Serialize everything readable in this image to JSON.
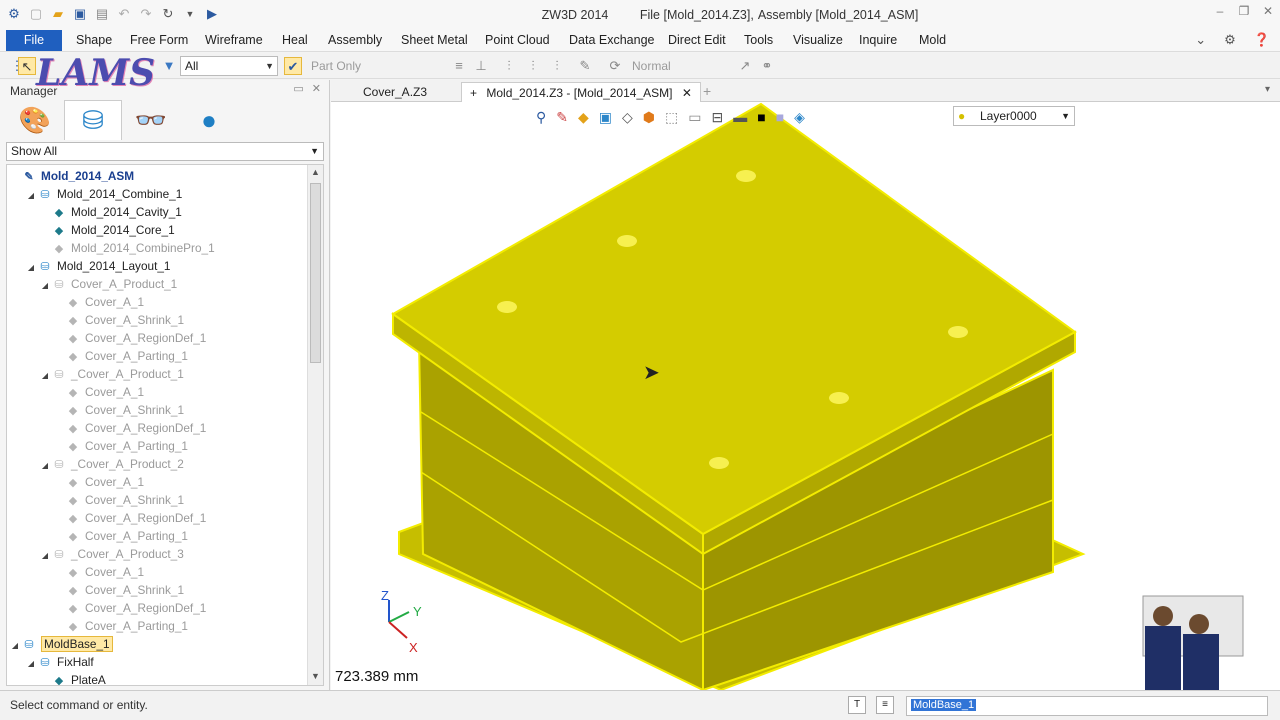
{
  "title": {
    "app": "ZW3D 2014",
    "file": "File [Mold_2014.Z3],",
    "object": "Assembly [Mold_2014_ASM]"
  },
  "menu": {
    "items": [
      "File",
      "Shape",
      "Free Form",
      "Wireframe",
      "Heal",
      "Assembly",
      "Sheet Metal",
      "Point Cloud",
      "Data Exchange",
      "Direct Edit",
      "Tools",
      "Visualize",
      "Inquire",
      "Mold"
    ]
  },
  "toolbar": {
    "filter": "All",
    "part_filter": "Part Only",
    "render_mode": "Normal"
  },
  "manager": {
    "title": "Manager",
    "show_filter": "Show All",
    "tree": [
      {
        "label": "Mold_2014_ASM",
        "depth": 0,
        "state": "root",
        "icon": "assembly-root-icon"
      },
      {
        "label": "Mold_2014_Combine_1",
        "depth": 1,
        "state": "normal",
        "icon": "assembly-icon",
        "exp": true
      },
      {
        "label": "Mold_2014_Cavity_1",
        "depth": 2,
        "state": "normal",
        "icon": "part-icon"
      },
      {
        "label": "Mold_2014_Core_1",
        "depth": 2,
        "state": "normal",
        "icon": "part-icon"
      },
      {
        "label": "Mold_2014_CombinePro_1",
        "depth": 2,
        "state": "dim",
        "icon": "part-icon"
      },
      {
        "label": "Mold_2014_Layout_1",
        "depth": 1,
        "state": "normal",
        "icon": "assembly-icon",
        "exp": true
      },
      {
        "label": "Cover_A_Product_1",
        "depth": 2,
        "state": "dim",
        "icon": "assembly-icon",
        "exp": true
      },
      {
        "label": "Cover_A_1",
        "depth": 3,
        "state": "dim",
        "icon": "part-icon"
      },
      {
        "label": "Cover_A_Shrink_1",
        "depth": 3,
        "state": "dim",
        "icon": "part-icon"
      },
      {
        "label": "Cover_A_RegionDef_1",
        "depth": 3,
        "state": "dim",
        "icon": "part-icon"
      },
      {
        "label": "Cover_A_Parting_1",
        "depth": 3,
        "state": "dim",
        "icon": "part-icon"
      },
      {
        "label": "_Cover_A_Product_1",
        "depth": 2,
        "state": "dim",
        "icon": "assembly-icon",
        "exp": true
      },
      {
        "label": "Cover_A_1",
        "depth": 3,
        "state": "dim",
        "icon": "part-icon"
      },
      {
        "label": "Cover_A_Shrink_1",
        "depth": 3,
        "state": "dim",
        "icon": "part-icon"
      },
      {
        "label": "Cover_A_RegionDef_1",
        "depth": 3,
        "state": "dim",
        "icon": "part-icon"
      },
      {
        "label": "Cover_A_Parting_1",
        "depth": 3,
        "state": "dim",
        "icon": "part-icon"
      },
      {
        "label": "_Cover_A_Product_2",
        "depth": 2,
        "state": "dim",
        "icon": "assembly-icon",
        "exp": true
      },
      {
        "label": "Cover_A_1",
        "depth": 3,
        "state": "dim",
        "icon": "part-icon"
      },
      {
        "label": "Cover_A_Shrink_1",
        "depth": 3,
        "state": "dim",
        "icon": "part-icon"
      },
      {
        "label": "Cover_A_RegionDef_1",
        "depth": 3,
        "state": "dim",
        "icon": "part-icon"
      },
      {
        "label": "Cover_A_Parting_1",
        "depth": 3,
        "state": "dim",
        "icon": "part-icon"
      },
      {
        "label": "_Cover_A_Product_3",
        "depth": 2,
        "state": "dim",
        "icon": "assembly-icon",
        "exp": true
      },
      {
        "label": "Cover_A_1",
        "depth": 3,
        "state": "dim",
        "icon": "part-icon"
      },
      {
        "label": "Cover_A_Shrink_1",
        "depth": 3,
        "state": "dim",
        "icon": "part-icon"
      },
      {
        "label": "Cover_A_RegionDef_1",
        "depth": 3,
        "state": "dim",
        "icon": "part-icon"
      },
      {
        "label": "Cover_A_Parting_1",
        "depth": 3,
        "state": "dim",
        "icon": "part-icon"
      },
      {
        "label": "MoldBase_1",
        "depth": 0,
        "state": "selected",
        "icon": "assembly-icon",
        "exp": true
      },
      {
        "label": "FixHalf",
        "depth": 1,
        "state": "normal",
        "icon": "assembly-icon",
        "exp": true
      },
      {
        "label": "PlateA",
        "depth": 2,
        "state": "normal",
        "icon": "part-icon"
      }
    ]
  },
  "doc_tabs": [
    {
      "label": "Cover_A.Z3",
      "active": false
    },
    {
      "label": "Mold_2014.Z3 - [Mold_2014_ASM]",
      "active": true
    }
  ],
  "viewport": {
    "layer": "Layer0000",
    "measurement": "723.389 mm",
    "axes": {
      "x": "X",
      "y": "Y",
      "z": "Z"
    },
    "model_color": "#d4cc00"
  },
  "status": {
    "prompt": "Select command or entity.",
    "selection": "MoldBase_1"
  },
  "overlay": {
    "logo_text": "LAMS"
  }
}
